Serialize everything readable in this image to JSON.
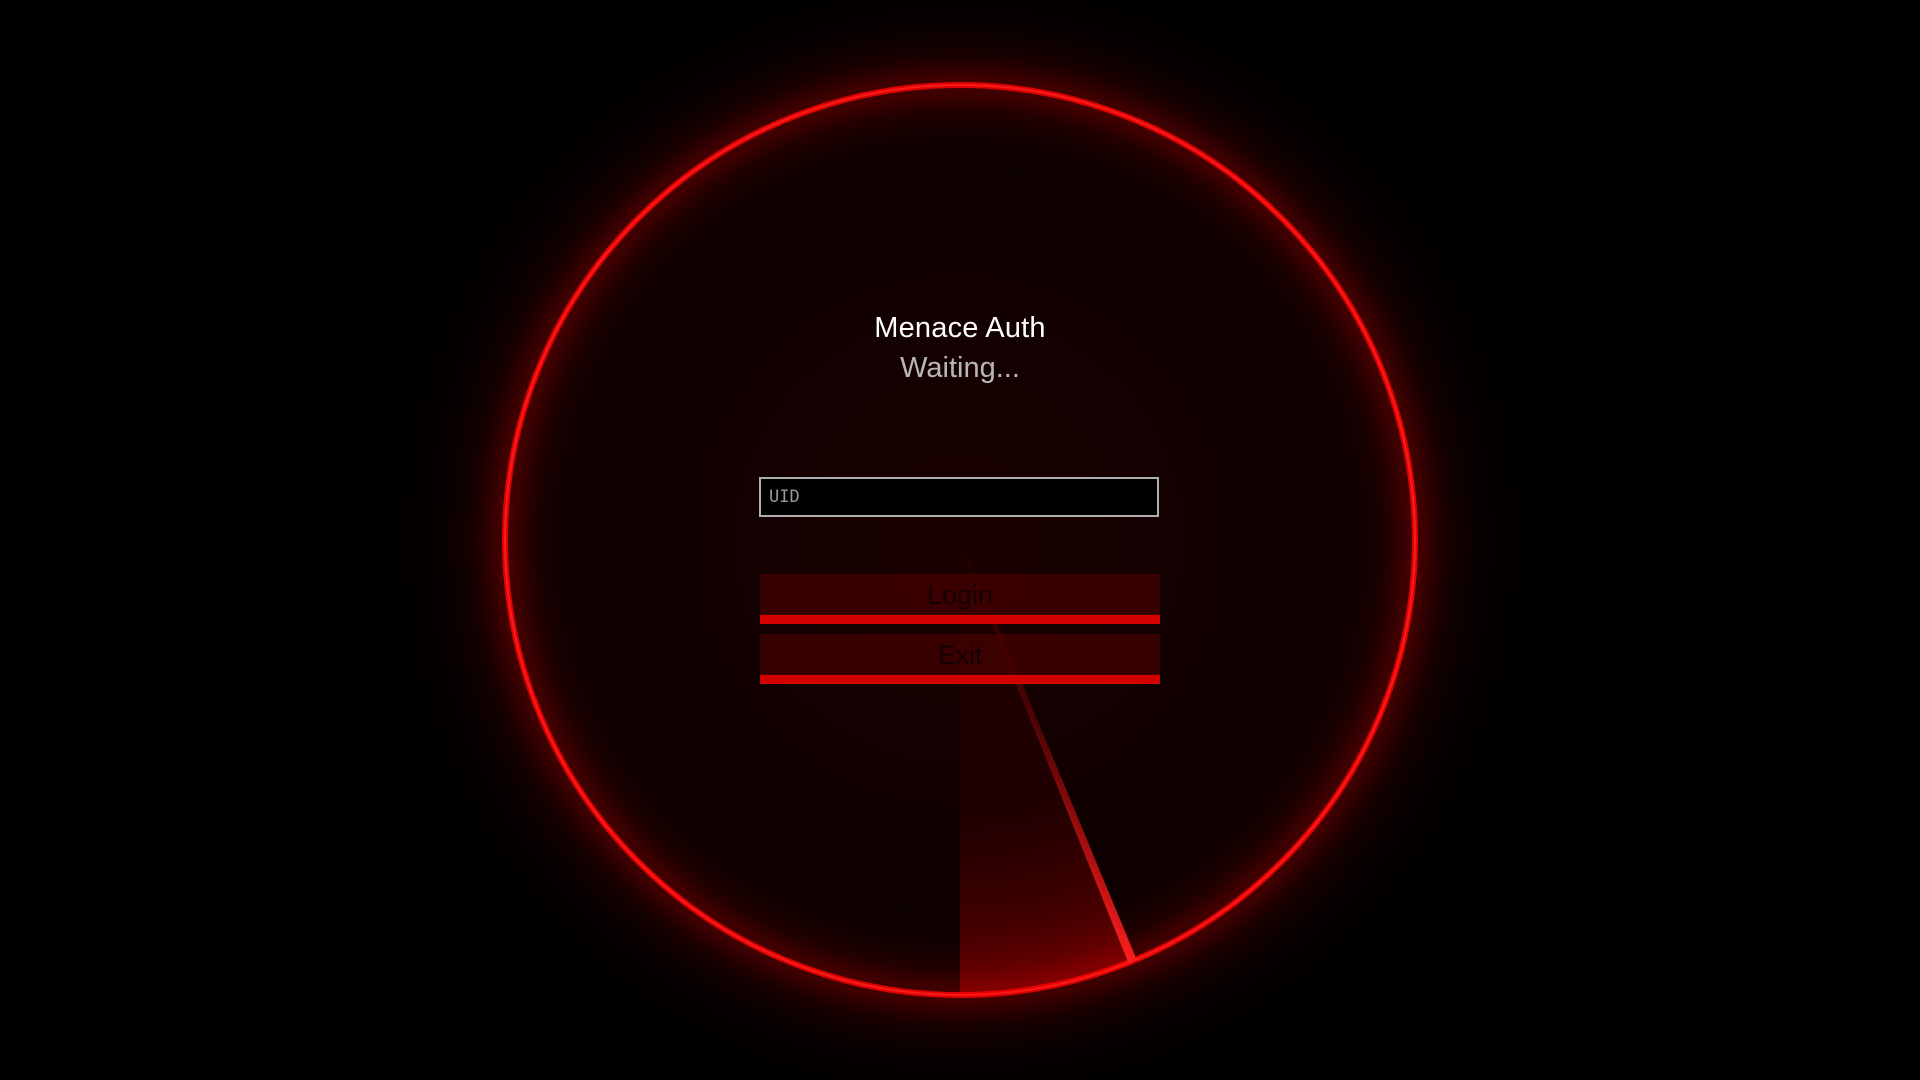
{
  "app": {
    "title": "Menace Auth",
    "status": "Waiting..."
  },
  "form": {
    "uid_placeholder": "UID",
    "uid_value": "",
    "login_label": "Login",
    "exit_label": "Exit"
  },
  "theme": {
    "background": "#000000",
    "accent": "#d20000",
    "ring_glow": "#ff0a0a",
    "button_fill": "#460000",
    "title_color": "#ffffff",
    "status_color": "#b8b8b8"
  }
}
